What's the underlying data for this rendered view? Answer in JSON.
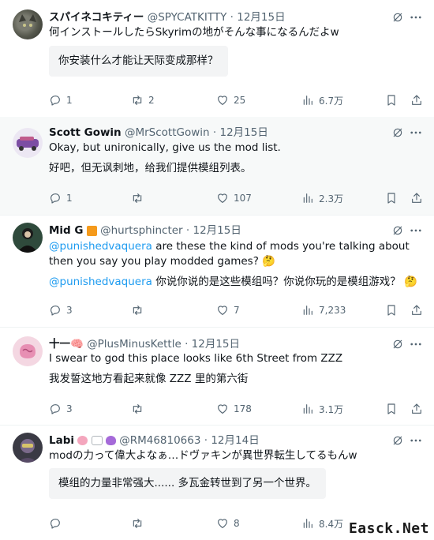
{
  "posts": [
    {
      "name": "スパイネコキティー",
      "handle": "@SPYCATKITTY",
      "dot": "·",
      "date": "12月15日",
      "text": "何インストールしたらSkyrimの地がそんな事になるんだよw",
      "translation": "你安装什么才能让天际变成那样？",
      "replies": "1",
      "reposts": "2",
      "likes": "25",
      "views": "6.7万"
    },
    {
      "name": "Scott Gowin",
      "handle": "@MrScottGowin",
      "dot": "·",
      "date": "12月15日",
      "text": "Okay, but unironically, give us the mod list.",
      "translation": "好吧，但无讽刺地，给我们提供模组列表。",
      "replies": "1",
      "reposts": "",
      "likes": "107",
      "views": "2.3万"
    },
    {
      "name": "Mid G",
      "handle": "@hurtsphincter",
      "dot": "·",
      "date": "12月15日",
      "mention": "@punishedvaquera",
      "text": " are these the kind of mods you're talking about then you say you play modded games? 🤔",
      "translation": " 你说你说的是这些模组吗？你说你玩的是模组游戏？ 🤔",
      "replies": "3",
      "reposts": "",
      "likes": "7",
      "views": "7,233"
    },
    {
      "name": "十一🧠",
      "handle": "@PlusMinusKettle",
      "dot": "·",
      "date": "12月15日",
      "text": "I swear to god this place looks like 6th Street from ZZZ",
      "translation": "我发誓这地方看起来就像 ZZZ 里的第六街",
      "replies": "3",
      "reposts": "",
      "likes": "178",
      "views": "3.1万"
    },
    {
      "name": "Labi",
      "handle": "@RM46810663",
      "dot": "·",
      "date": "12月14日",
      "text": "modの力って偉大よなぁ…ドヴァキンが異世界転生してるもんw",
      "translation": "模组的力量非常强大...... 多瓦金转世到了另一个世界。",
      "replies": "",
      "reposts": "",
      "likes": "8",
      "views": "8.4万"
    }
  ],
  "watermark": "Easck.Net",
  "icons": [
    "reply-icon",
    "repost-icon",
    "like-icon",
    "views-icon",
    "bookmark-icon",
    "share-icon",
    "grok-icon",
    "more-icon"
  ],
  "colors": {
    "text": "#0f1419",
    "muted": "#536471",
    "link": "#1d9bf0",
    "divider": "#eff3f4"
  }
}
